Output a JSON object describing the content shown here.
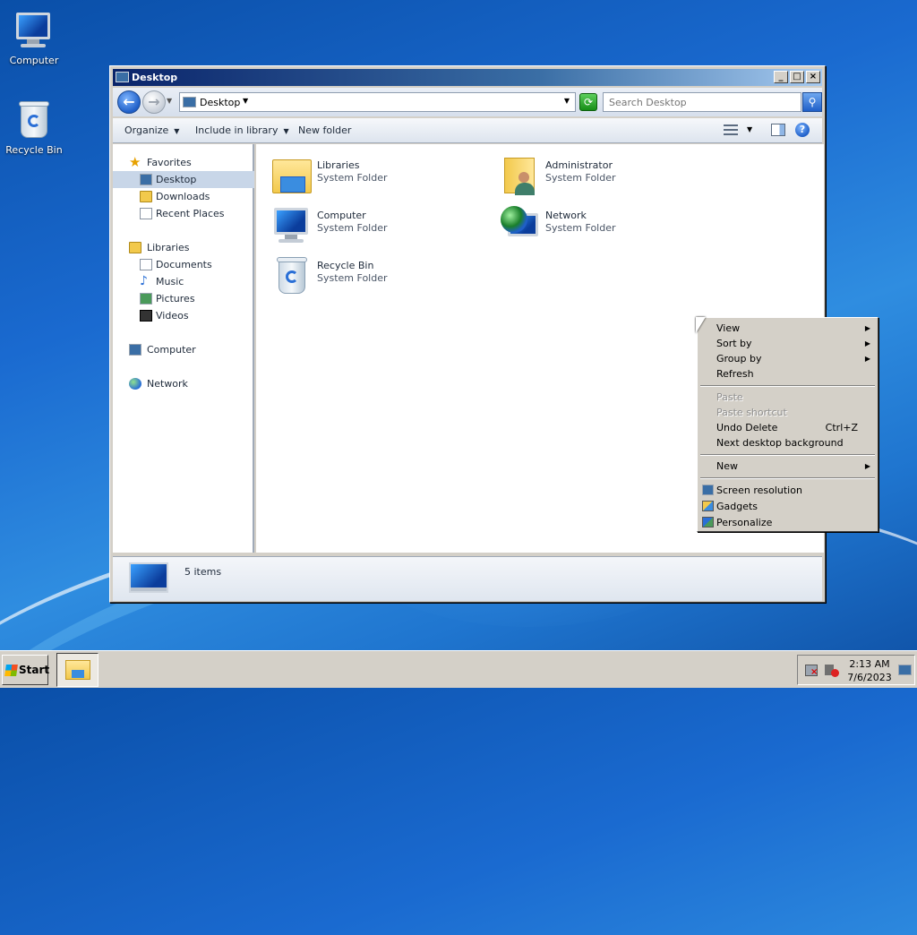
{
  "desktop": {
    "icons": [
      {
        "label": "Computer"
      },
      {
        "label": "Recycle Bin"
      }
    ]
  },
  "window": {
    "title": "Desktop",
    "controls": {
      "minimize": "_",
      "maximize": "□",
      "close": "×"
    },
    "address": {
      "location": "Desktop"
    },
    "search": {
      "placeholder": "Search Desktop"
    },
    "commands": {
      "organize": "Organize",
      "include_in_library": "Include in library",
      "new_folder": "New folder"
    },
    "nav": {
      "favorites": "Favorites",
      "favorites_items": [
        "Desktop",
        "Downloads",
        "Recent Places"
      ],
      "libraries": "Libraries",
      "libraries_items": [
        "Documents",
        "Music",
        "Pictures",
        "Videos"
      ],
      "computer": "Computer",
      "network": "Network"
    },
    "items": [
      {
        "name": "Libraries",
        "type": "System Folder"
      },
      {
        "name": "Administrator",
        "type": "System Folder"
      },
      {
        "name": "Computer",
        "type": "System Folder"
      },
      {
        "name": "Network",
        "type": "System Folder"
      },
      {
        "name": "Recycle Bin",
        "type": "System Folder"
      }
    ],
    "details": {
      "count": "5 items"
    }
  },
  "context_menu": {
    "view": "View",
    "sort_by": "Sort by",
    "group_by": "Group by",
    "refresh": "Refresh",
    "paste": "Paste",
    "paste_shortcut": "Paste shortcut",
    "undo_delete": "Undo Delete",
    "undo_delete_shortcut": "Ctrl+Z",
    "next_background": "Next desktop background",
    "new": "New",
    "screen_resolution": "Screen resolution",
    "gadgets": "Gadgets",
    "personalize": "Personalize",
    "submenu_arrow": "▶"
  },
  "taskbar": {
    "start": "Start",
    "time": "2:13 AM",
    "date": "7/6/2023"
  },
  "glyphs": {
    "back": "←",
    "forward": "→",
    "caret": "▼",
    "refresh": "⟳",
    "search": "⚲",
    "help": "?",
    "star": "★",
    "music": "♪"
  }
}
